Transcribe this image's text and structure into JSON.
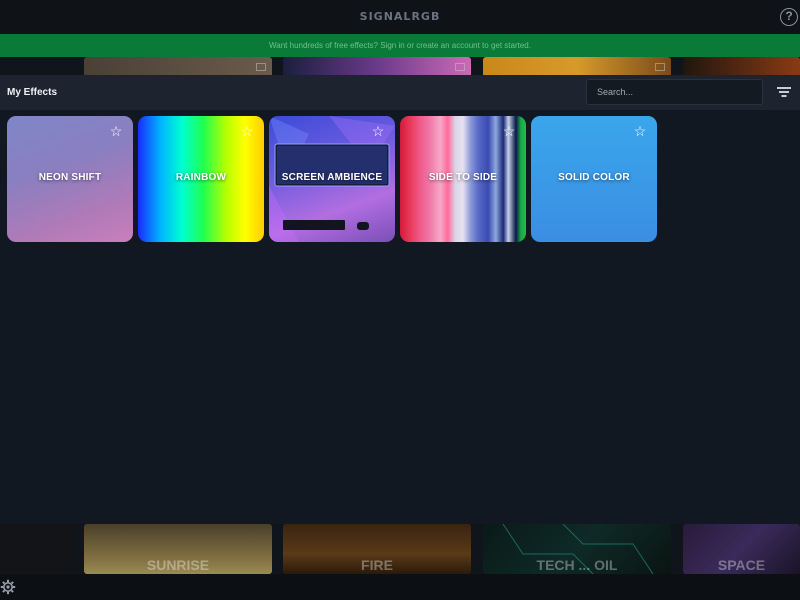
{
  "app": {
    "brand": "SIGNALRGB",
    "help_icon": "question-circle-icon"
  },
  "banner": {
    "text": "Want hundreds of free effects? Sign in or create an account to get started.",
    "color": "#0a7a38"
  },
  "background_gallery": {
    "bottom_labels": [
      "SUNRISE",
      "FIRE",
      "TECH ... OIL",
      "SPACE"
    ]
  },
  "panel": {
    "title": "My Effects",
    "search": {
      "placeholder": "Search...",
      "value": ""
    },
    "filter_icon": "filter-lines-icon"
  },
  "effects": [
    {
      "label": "NEON SHIFT",
      "favorite": false,
      "icon": "star-outline-icon"
    },
    {
      "label": "RAINBOW",
      "favorite": false,
      "icon": "star-outline-icon"
    },
    {
      "label": "SCREEN AMBIENCE",
      "favorite": false,
      "icon": "star-outline-icon"
    },
    {
      "label": "SIDE TO SIDE",
      "favorite": false,
      "icon": "star-outline-icon"
    },
    {
      "label": "SOLID COLOR",
      "favorite": false,
      "icon": "star-outline-icon"
    }
  ],
  "statusbar": {
    "settings_icon": "gear-icon"
  }
}
